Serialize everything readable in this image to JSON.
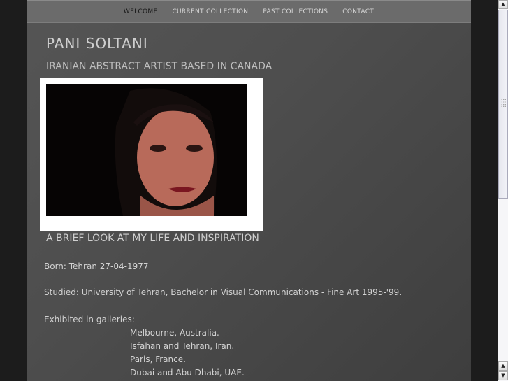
{
  "nav": {
    "items": [
      "WELCOME",
      "CURRENT COLLECTION",
      "PAST COLLECTIONS",
      "CONTACT"
    ],
    "active": "WELCOME"
  },
  "header": {
    "title": "PANI SOLTANI",
    "subtitle": "IRANIAN ABSTRACT ARTIST BASED IN CANADA"
  },
  "section": {
    "heading": "A BRIEF LOOK AT MY LIFE AND INSPIRATION"
  },
  "bio": {
    "born": "Born: Tehran 27-04-1977",
    "studied": "Studied: University of Tehran, Bachelor in Visual Communications - Fine Art 1995-'99.",
    "exhibited_label": "Exhibited in galleries:",
    "galleries": [
      "Melbourne, Australia.",
      "Isfahan and Tehran, Iran.",
      "Paris, France.",
      "Dubai and Abu Dhabi, UAE."
    ]
  }
}
